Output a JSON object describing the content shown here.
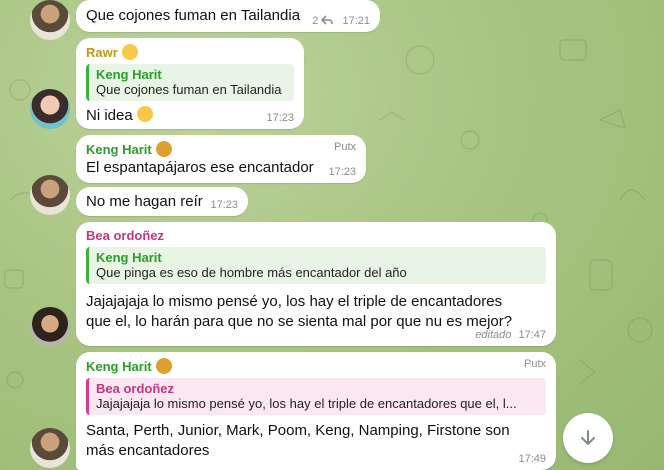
{
  "messages": [
    {
      "text": "Que cojones fuman en Tailandia",
      "replies": "2",
      "time": "17:21"
    },
    {
      "sender": "Rawr",
      "reply_name": "Keng Harit",
      "reply_text": "Que cojones fuman en Tailandia",
      "text": "Ni idea",
      "time": "17:23"
    },
    {
      "sender": "Keng Harit",
      "role": "Putx",
      "text": "El espantapájaros ese encantador",
      "time": "17:23"
    },
    {
      "text": "No me hagan reír",
      "time": "17:23"
    },
    {
      "sender": "Bea ordoñez",
      "reply_name": "Keng Harit",
      "reply_text": "Que pinga es eso de hombre más encantador del año",
      "text_line1": "Jajajajaja lo mismo pensé yo, los hay el triple de encantadores",
      "text_line2": "que el, lo harán para que no se sienta mal por que  nu es mejor?",
      "edited": "editado",
      "time": "17:47"
    },
    {
      "sender": "Keng Harit",
      "role": "Putx",
      "reply_name": "Bea ordoñez",
      "reply_text": "Jajajajaja lo mismo pensé yo, los hay el triple de encantadores que el, l...",
      "text_line1": "Santa, Perth, Junior, Mark, Poom, Keng, Namping, Firstone son",
      "text_line2": "más encantadores",
      "time": "17:49"
    }
  ],
  "colors": {
    "sender_green": "#2a9d2a",
    "sender_pink": "#c2377f",
    "bubble": "#ffffff",
    "background": "#a9c483"
  },
  "icons": {
    "reply_arrow": "reply-arrow-icon",
    "scroll_down": "arrow-down-icon"
  }
}
